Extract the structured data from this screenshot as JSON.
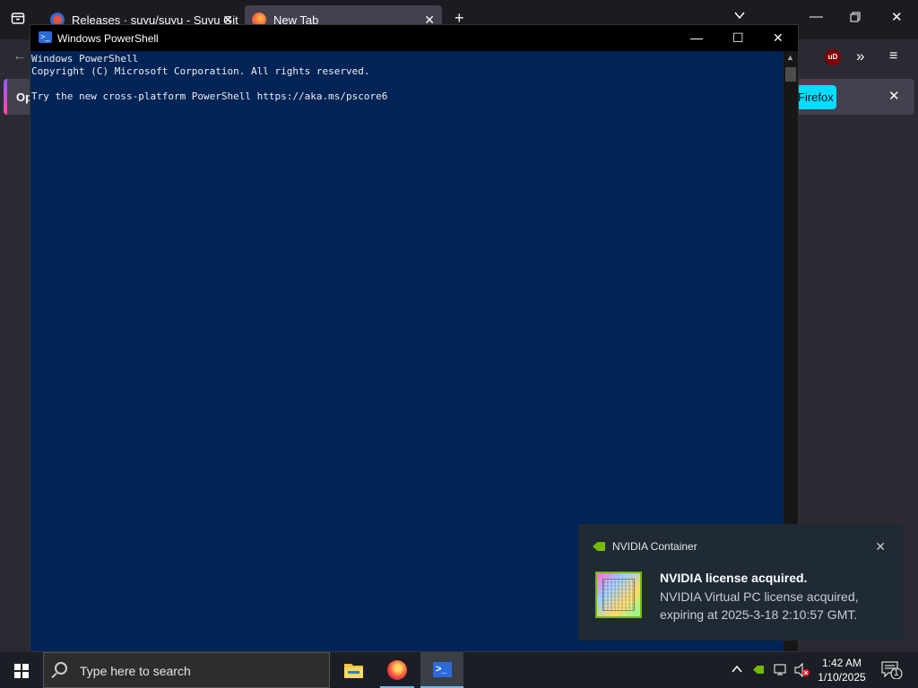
{
  "browser": {
    "tabs": [
      {
        "title": "Releases · suyu/suyu - Suyu Git",
        "active": false,
        "favicon": "gitea-icon"
      },
      {
        "title": "New Tab",
        "active": true,
        "favicon": "firefox-icon"
      }
    ],
    "new_tab_symbol": "+",
    "notice_text_left": "Op",
    "notice_button_text": "Firefox",
    "notice_close": "✕",
    "extension_badge": "uD"
  },
  "powershell": {
    "title": "Windows PowerShell",
    "console_lines": [
      "Windows PowerShell",
      "Copyright (C) Microsoft Corporation. All rights reserved.",
      "",
      "Try the new cross-platform PowerShell https://aka.ms/pscore6"
    ],
    "controls": {
      "minimize": "—",
      "maximize": "☐",
      "close": "✕"
    }
  },
  "toast": {
    "app_name": "NVIDIA Container",
    "headline": "NVIDIA license acquired.",
    "body": "NVIDIA Virtual PC license acquired, expiring at 2025-3-18 2:10:57 GMT.",
    "close": "✕",
    "accent": "#76b900"
  },
  "taskbar": {
    "search_placeholder": "Type here to search",
    "apps": [
      {
        "name": "file-explorer",
        "active": false
      },
      {
        "name": "firefox",
        "active": false
      },
      {
        "name": "powershell",
        "active": true
      }
    ],
    "clock_time": "1:42 AM",
    "clock_date": "1/10/2025",
    "notification_count": "1"
  },
  "colors": {
    "powershell_bg": "#012456",
    "taskbar_bg": "#1b1f25",
    "firefox_bg": "#2b2a33"
  }
}
